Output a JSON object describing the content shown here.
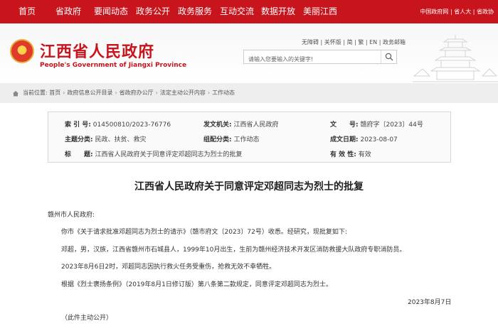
{
  "topnav": {
    "items": [
      "首页",
      "省政府",
      "要闻动态",
      "政务公开",
      "政务服务",
      "互动交流",
      "数据开放",
      "美丽江西"
    ],
    "right_links": [
      "中国政府网",
      "省人大",
      "省政协"
    ]
  },
  "header": {
    "title": "江西省人民政府",
    "subtitle": "People's Government of Jiangxi Province",
    "tools": [
      "无障碍",
      "关怀版",
      "简",
      "繁",
      "EN",
      "政务邮箱"
    ],
    "search_placeholder": "请输入您要输入的关键字!"
  },
  "breadcrumb": {
    "label": "当前位置:",
    "items": [
      "首页",
      "政府信息公开目录",
      "省政府办公厅",
      "法定主动公开内容",
      "工作动态"
    ]
  },
  "meta": {
    "index_key": "索 引 号:",
    "index_val": "014500810/2023-76776",
    "issuer_key": "发文机关:",
    "issuer_val": "江西省人民政府",
    "docno_key": "文　　号:",
    "docno_val": "赣府字〔2023〕44号",
    "topic_key": "主题分类:",
    "topic_val": "民政、扶贫、救灾",
    "category_key": "组配分类:",
    "category_val": "工作动态",
    "date_key": "成文日期:",
    "date_val": "2023-08-07",
    "title_key": "标　　题:",
    "title_val": "江西省人民政府关于同意评定邓超同志为烈士的批复",
    "validity_key": "有 效 性:",
    "validity_val": "有效"
  },
  "doc": {
    "title": "江西省人民政府关于同意评定邓超同志为烈士的批复",
    "recipient": "赣州市人民政府:",
    "p1": "你市《关于请求批准邓超同志为烈士的请示》（赣市府文〔2023〕72号）收悉。经研究，现批复如下:",
    "p2": "邓超，男，汉族，江西省赣州市石城县人，1999年10月出生，生前为赣州经济技术开发区消防救援大队政府专职消防员。",
    "p3": "2023年8月6日2时，邓超同志因执行救火任务受重伤，抢救无效不幸牺牲。",
    "p4": "根据《烈士褒扬条例》（2019年8月1日修订版）第八条第二款规定，同意评定邓超同志为烈士。",
    "date": "2023年8月7日",
    "note": "（此件主动公开）"
  },
  "colors": {
    "brand_red": "#c8141c",
    "breadcrumb_bg": "#eeeeee"
  }
}
